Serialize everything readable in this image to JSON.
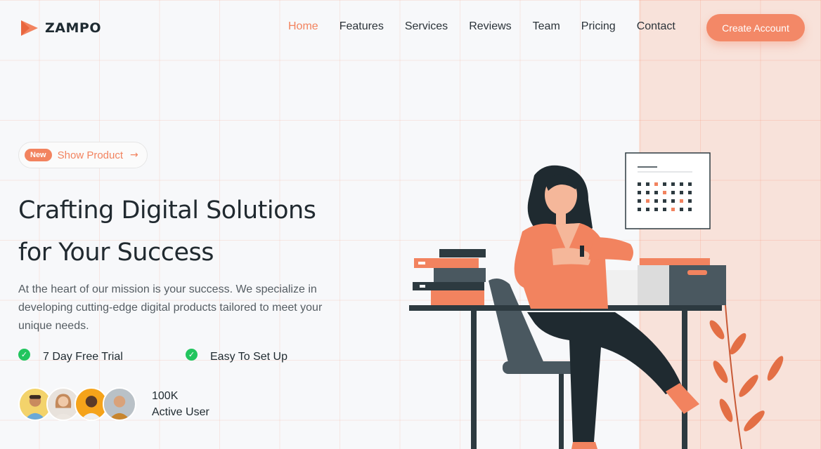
{
  "brand": {
    "name": "ZAMPO",
    "color": "#f2835f"
  },
  "nav": {
    "items": [
      "Home",
      "Features",
      "Services",
      "Reviews",
      "Team",
      "Pricing",
      "Contact"
    ],
    "active": "Home"
  },
  "cta_label": "Create Account",
  "hero": {
    "badge": "New",
    "pill_text": "Show Product",
    "title_line1": "Crafting Digital Solutions",
    "title_line2": "for Your Success",
    "description": "At the heart of our mission is your success. We specialize in developing cutting-edge digital products tailored to meet your unique needs.",
    "features": [
      "7 Day Free Trial",
      "Easy To Set Up"
    ],
    "user_count": "100K",
    "user_label": "Active User"
  },
  "icons": {
    "logo": "play-arrow-logo-icon",
    "arrow": "arrow-right-icon",
    "check": "check-circle-icon"
  },
  "colors": {
    "accent": "#f2835f",
    "success": "#22c55e",
    "panel": "#f8e2da"
  }
}
